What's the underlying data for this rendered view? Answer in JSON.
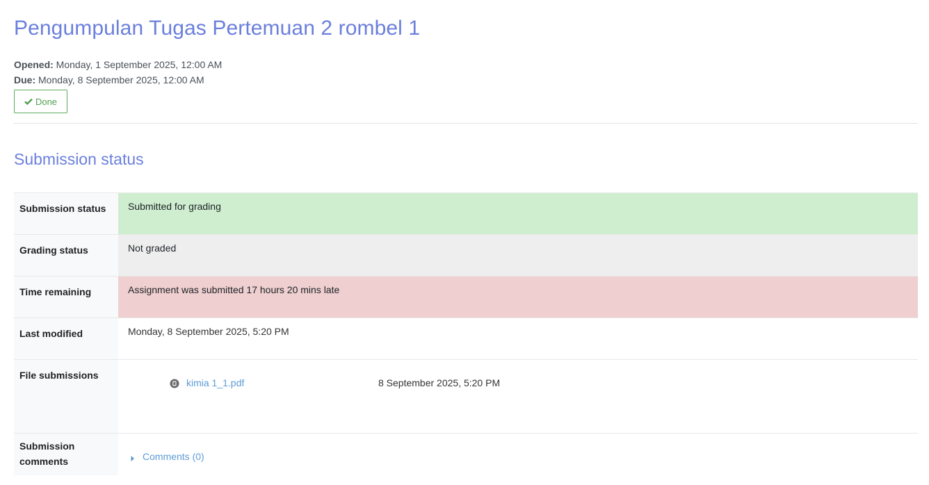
{
  "page": {
    "title": "Pengumpulan Tugas Pertemuan 2 rombel 1",
    "opened_label": "Opened:",
    "opened_value": "Monday, 1 September 2025, 12:00 AM",
    "due_label": "Due:",
    "due_value": "Monday, 8 September 2025, 12:00 AM",
    "done_button": "Done"
  },
  "submission": {
    "section_title": "Submission status",
    "rows": [
      {
        "label": "Submission status",
        "value": "Submitted for grading",
        "color": "#cfeed0"
      },
      {
        "label": "Grading status",
        "value": "Not graded",
        "color": "#eeeeee"
      },
      {
        "label": "Time remaining",
        "value": "Assignment was submitted 17 hours 20 mins late",
        "color": "#efcfd0"
      },
      {
        "label": "Last modified",
        "value": "Monday, 8 September 2025, 5:20 PM",
        "color": "#ffffff"
      }
    ],
    "file_submissions": {
      "label": "File submissions",
      "files": [
        {
          "name": "kimia 1_1.pdf",
          "date": "8 September 2025, 5:20 PM",
          "icon": "pdf-file-icon"
        }
      ]
    },
    "comments": {
      "label": "Submission comments",
      "link": "Comments (0)"
    }
  },
  "colors": {
    "accent": "#6b7fdc",
    "link": "#5b9bd5",
    "done": "#4fa04f"
  }
}
